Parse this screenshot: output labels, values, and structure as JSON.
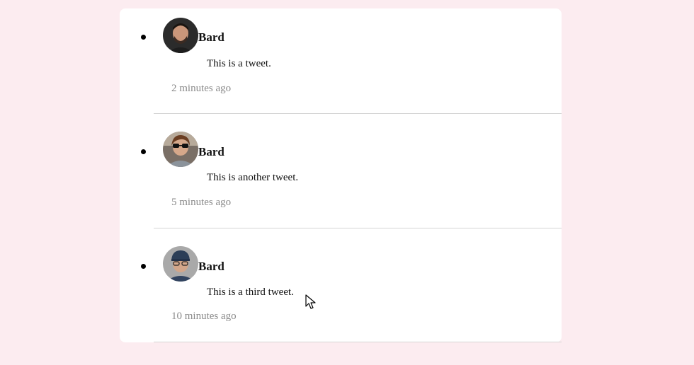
{
  "tweets": [
    {
      "username": "Bard",
      "text": "This is a tweet.",
      "time": "2 minutes ago",
      "avatar": "avatar-photo-dark-hair-man"
    },
    {
      "username": "Bard",
      "text": "This is another tweet.",
      "time": "5 minutes ago",
      "avatar": "avatar-photo-sunglasses-man"
    },
    {
      "username": "Bard",
      "text": "This is a third tweet.",
      "time": "10 minutes ago",
      "avatar": "avatar-photo-cap-man"
    }
  ],
  "colors": {
    "background": "#fcecf0",
    "card": "#ffffff",
    "timestamp": "#8a8a8a",
    "divider": "#d4d4d4"
  },
  "icons": {
    "bullet": "bullet-dot-icon",
    "cursor": "mouse-pointer-icon"
  }
}
